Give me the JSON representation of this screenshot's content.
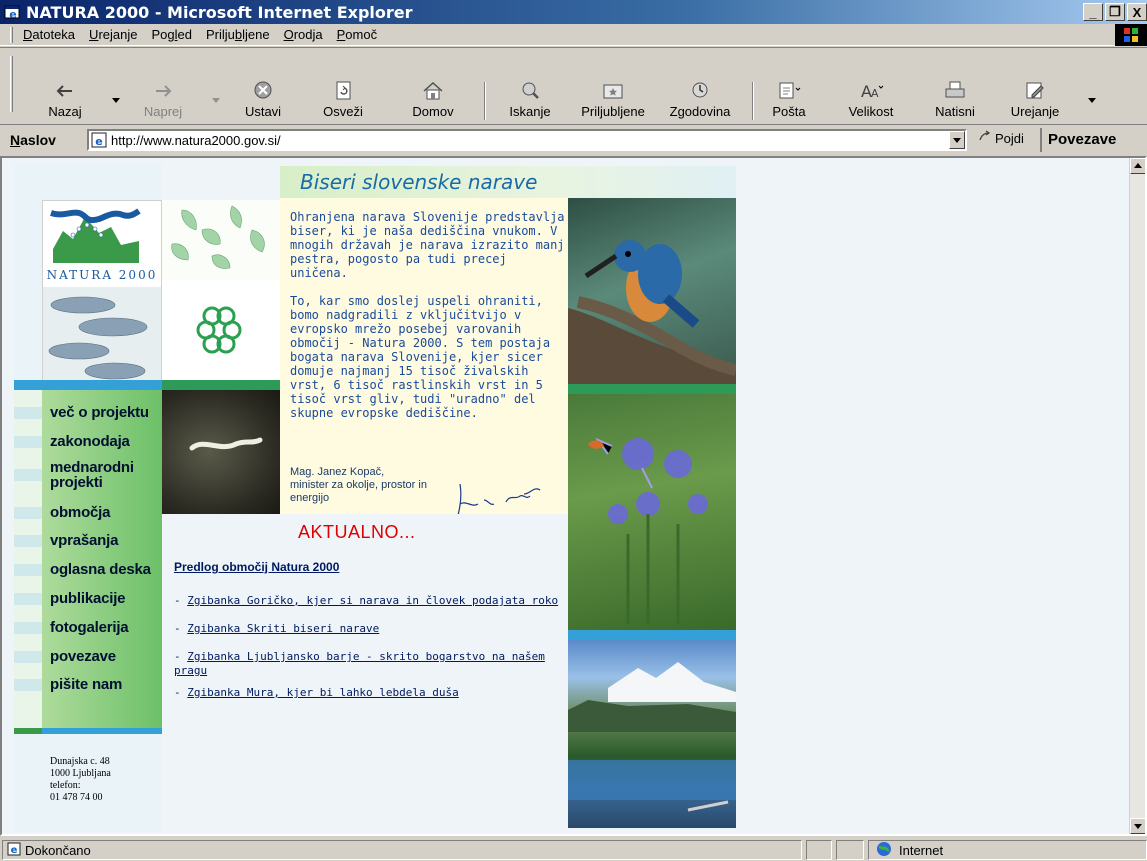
{
  "window": {
    "title": "NATURA 2000 - Microsoft Internet Explorer",
    "min": "_",
    "restore": "❐",
    "close": "X"
  },
  "menu": {
    "items": [
      {
        "pre": "",
        "acc": "D",
        "post": "atoteka"
      },
      {
        "pre": "",
        "acc": "U",
        "post": "rejanje"
      },
      {
        "pre": "Pog",
        "acc": "l",
        "post": "ed"
      },
      {
        "pre": "Prilju",
        "acc": "b",
        "post": "ljene"
      },
      {
        "pre": "",
        "acc": "O",
        "post": "rodja"
      },
      {
        "pre": "",
        "acc": "P",
        "post": "omoč"
      }
    ]
  },
  "toolbar": {
    "back": "Nazaj",
    "forward": "Naprej",
    "stop": "Ustavi",
    "refresh": "Osveži",
    "home": "Domov",
    "search": "Iskanje",
    "favorites": "Priljubljene",
    "history": "Zgodovina",
    "mail": "Pošta",
    "size": "Velikost",
    "print": "Natisni",
    "edit": "Urejanje"
  },
  "address": {
    "label": "Naslov",
    "url": "http://www.natura2000.gov.si/",
    "go": "Pojdi",
    "links": "Povezave"
  },
  "page": {
    "banner": "Biseri slovenske narave",
    "logo_text": "NATURA 2000",
    "intro_p1": "Ohranjena narava Slovenije predstavlja biser, ki je naša dediščina vnukom. V mnogih državah je narava izrazito manj pestra, pogosto pa tudi precej uničena.",
    "intro_p2": "To, kar smo doslej uspeli ohraniti, bomo nadgradili z vključitvijo v evropsko mrežo posebej varovanih območij - Natura 2000. S tem postaja bogata narava Slovenije, kjer sicer domuje najmanj 15 tisoč živalskih vrst, 6 tisoč rastlinskih vrst in 5 tisoč vrst gliv, tudi \"uradno\" del skupne evropske dediščine.",
    "sig_line1": "Mag. Janez Kopač,",
    "sig_line2": "minister za okolje, prostor in energijo",
    "nav": [
      "več o projektu",
      "zakonodaja",
      "mednarodni projekti",
      "območja",
      "vprašanja",
      "oglasna deska",
      "publikacije",
      "fotogalerija",
      "povezave",
      "pišite nam"
    ],
    "contact": {
      "street": "Dunajska c. 48",
      "city": "1000 Ljubljana",
      "phone_label": "telefon:",
      "phone": "01 478 74 00"
    },
    "aktualno": "AKTUALNO...",
    "news_headline": "Predlog območij Natura 2000",
    "news": [
      "Zgibanka Goričko, kjer si narava in človek podajata roko",
      "Zgibanka Skriti biseri narave",
      "Zgibanka Ljubljansko barje - skrito bogarstvo na našem pragu",
      "Zgibanka Mura, kjer bi lahko lebdela duša"
    ],
    "news_prefix": "- "
  },
  "status": {
    "text": "Dokončano",
    "zone": "Internet"
  }
}
